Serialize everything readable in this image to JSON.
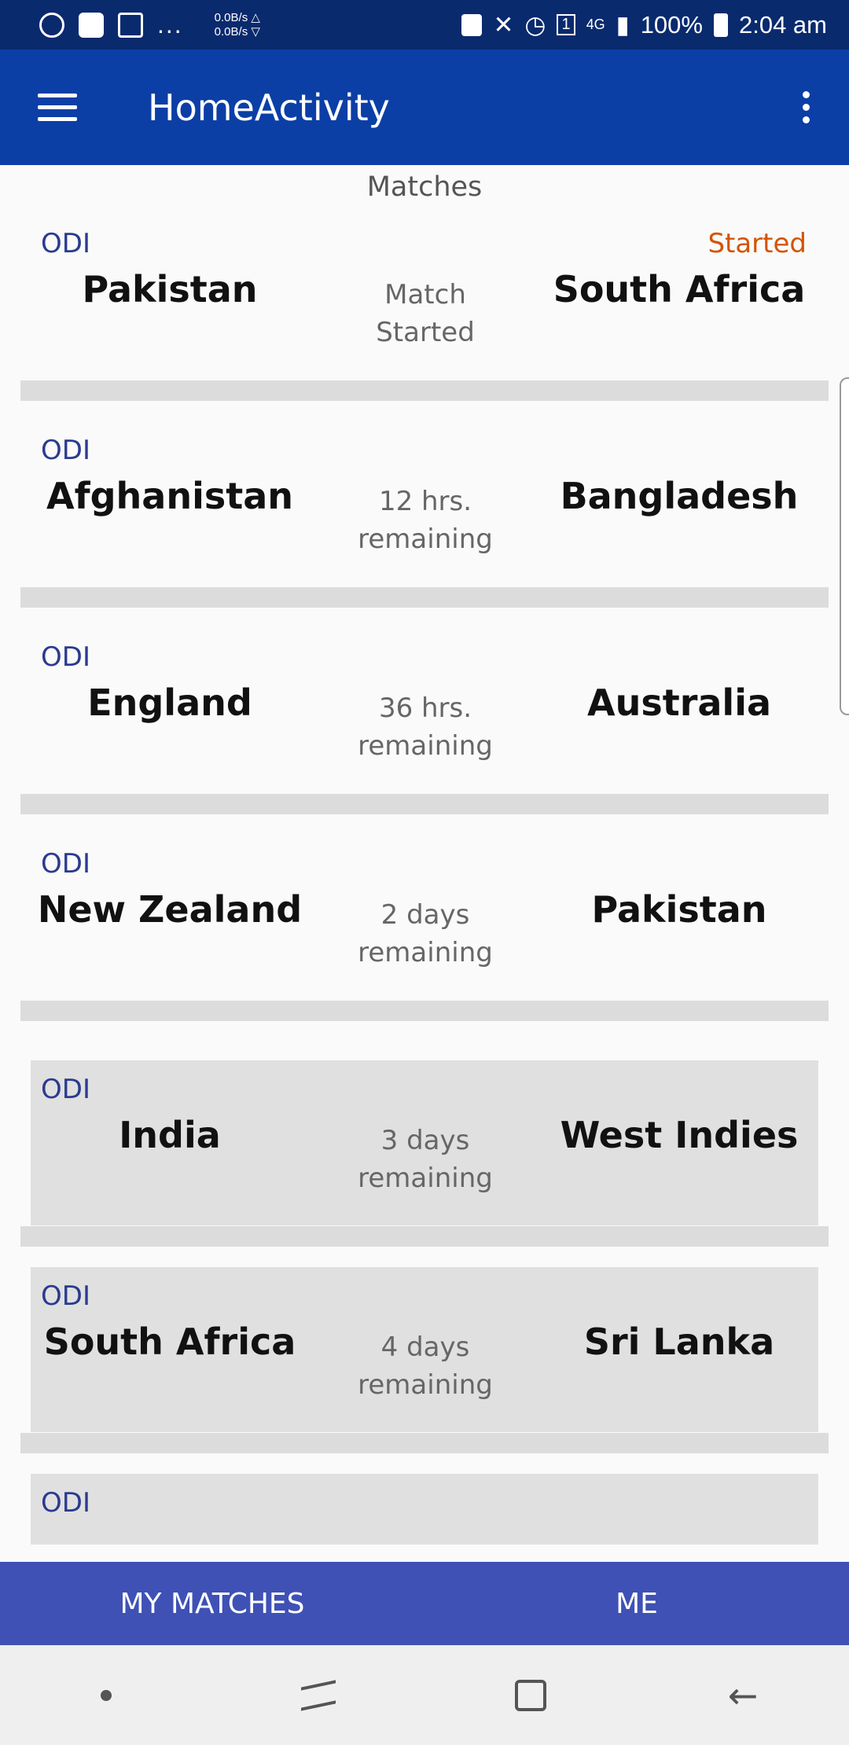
{
  "status_bar": {
    "speed_up": "0.0B/s △",
    "speed_down": "0.0B/s ▽",
    "sim_badge": "1",
    "network": "4G",
    "battery": "100%",
    "time": "2:04 am"
  },
  "app_bar": {
    "title": "HomeActivity"
  },
  "section": {
    "title": "Matches"
  },
  "matches": [
    {
      "format": "ODI",
      "team1": "Pakistan",
      "team2": "South Africa",
      "remaining_line1": "Match",
      "remaining_line2": "Started",
      "status": "Started"
    },
    {
      "format": "ODI",
      "team1": "Afghanistan",
      "team2": "Bangladesh",
      "remaining_line1": "12 hrs.",
      "remaining_line2": "remaining",
      "status": ""
    },
    {
      "format": "ODI",
      "team1": "England",
      "team2": "Australia",
      "remaining_line1": "36 hrs.",
      "remaining_line2": "remaining",
      "status": ""
    },
    {
      "format": "ODI",
      "team1": "New Zealand",
      "team2": "Pakistan",
      "remaining_line1": "2 days",
      "remaining_line2": "remaining",
      "status": ""
    },
    {
      "format": "ODI",
      "team1": "India",
      "team2": "West Indies",
      "remaining_line1": "3 days",
      "remaining_line2": "remaining",
      "status": ""
    },
    {
      "format": "ODI",
      "team1": "South Africa",
      "team2": "Sri Lanka",
      "remaining_line1": "4 days",
      "remaining_line2": "remaining",
      "status": ""
    },
    {
      "format": "ODI"
    }
  ],
  "bottom_tabs": {
    "my_matches": "MY MATCHES",
    "me": "ME"
  },
  "colors": {
    "status_bar": "#0a2a6e",
    "app_bar": "#0b3fa6",
    "bottom_tabs": "#3f51b5",
    "format_text": "#2a3b8f",
    "started_text": "#d35400"
  }
}
